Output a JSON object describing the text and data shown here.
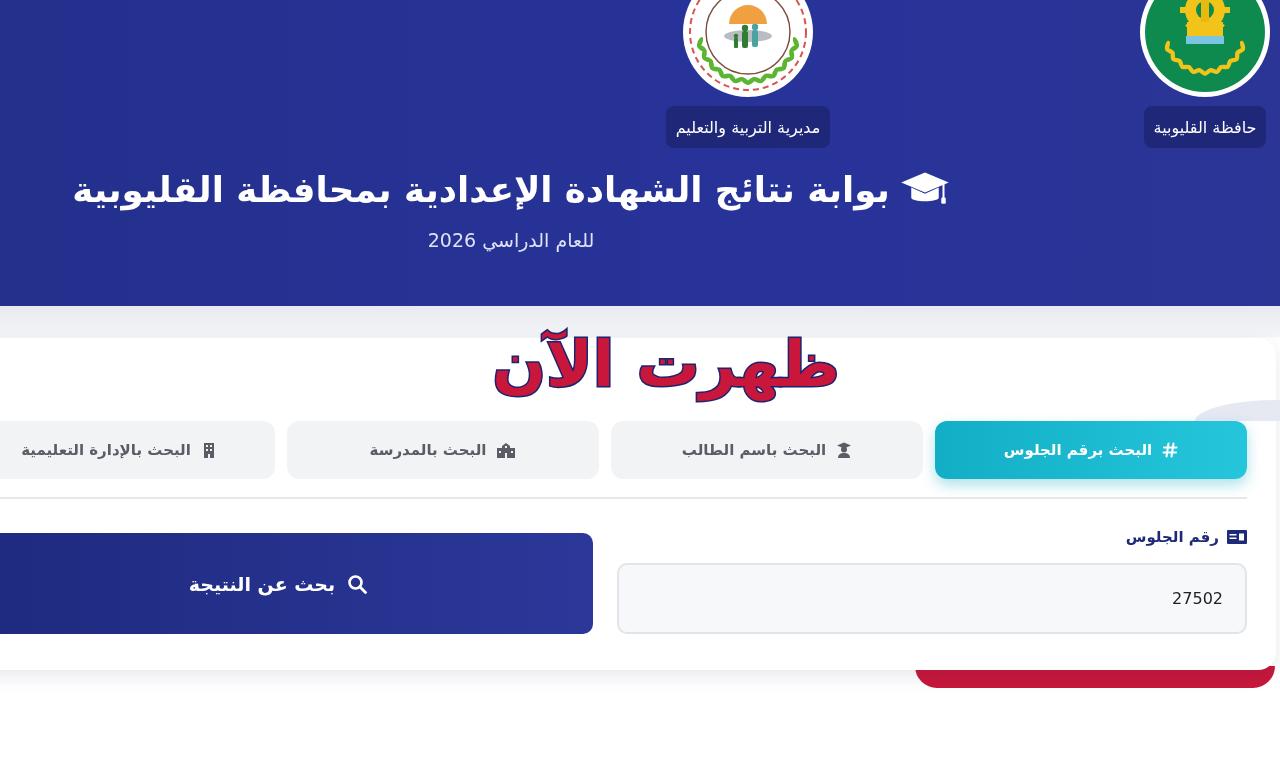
{
  "header": {
    "logos": [
      {
        "kind": "governorate",
        "label": "حافظة القليوبية"
      },
      {
        "kind": "directorate",
        "label": "مديرية التربية والتعليم"
      }
    ],
    "title": "بوابة نتائج الشهادة الإعدادية بمحافظة القليوبية",
    "subtitle": "للعام الدراسي 2026"
  },
  "overlay_text": "ظهرت الآن",
  "tabs": [
    {
      "kind": "seat_number",
      "label": "البحث برقم الجلوس",
      "selected": true
    },
    {
      "kind": "student_name",
      "label": "البحث باسم الطالب",
      "selected": false
    },
    {
      "kind": "school",
      "label": "البحث بالمدرسة",
      "selected": false
    },
    {
      "kind": "administration",
      "label": "البحث بالإدارة التعليمية",
      "selected": false
    }
  ],
  "form": {
    "field_label": "رقم الجلوس",
    "value": "27502",
    "submit_button": "بحث عن النتيجة"
  }
}
